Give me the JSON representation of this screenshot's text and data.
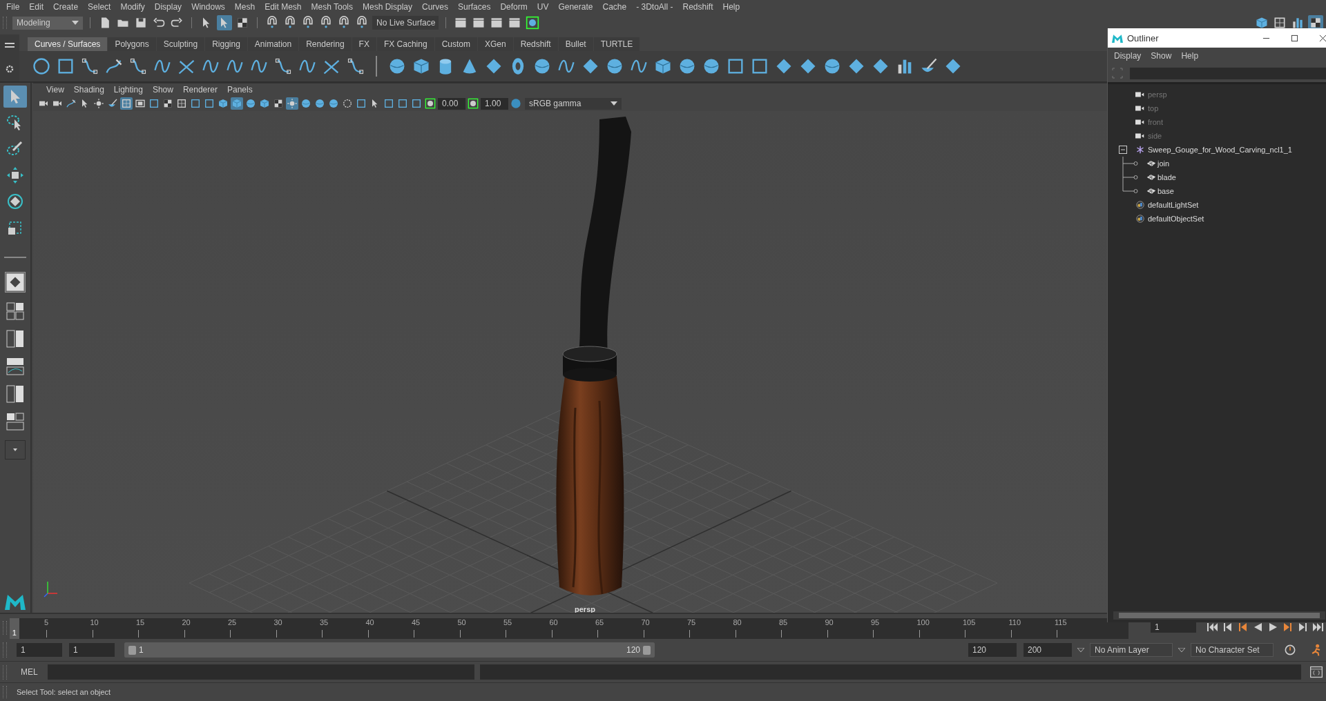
{
  "menu_bar": [
    "File",
    "Edit",
    "Create",
    "Select",
    "Modify",
    "Display",
    "Windows",
    "Mesh",
    "Edit Mesh",
    "Mesh Tools",
    "Mesh Display",
    "Curves",
    "Surfaces",
    "Deform",
    "UV",
    "Generate",
    "Cache",
    "- 3DtoAll -",
    "Redshift",
    "Help"
  ],
  "status_line": {
    "mode": "Modeling",
    "live_surface": "No Live Surface"
  },
  "shelf": {
    "tabs": [
      {
        "label": "Curves / Surfaces",
        "selected": true
      },
      {
        "label": "Polygons",
        "selected": false
      },
      {
        "label": "Sculpting",
        "selected": false
      },
      {
        "label": "Rigging",
        "selected": false
      },
      {
        "label": "Animation",
        "selected": false
      },
      {
        "label": "Rendering",
        "selected": false
      },
      {
        "label": "FX",
        "selected": false
      },
      {
        "label": "FX Caching",
        "selected": false
      },
      {
        "label": "Custom",
        "selected": false
      },
      {
        "label": "XGen",
        "selected": false
      },
      {
        "label": "Redshift",
        "selected": false
      },
      {
        "label": "Bullet",
        "selected": false
      },
      {
        "label": "TURTLE",
        "selected": false
      }
    ]
  },
  "toolbox": [
    {
      "kind": "select",
      "selected": true
    },
    {
      "kind": "lasso",
      "selected": false
    },
    {
      "kind": "paint",
      "selected": false
    },
    {
      "kind": "move",
      "selected": false
    },
    {
      "kind": "rotate",
      "selected": false
    },
    {
      "kind": "scale",
      "selected": false
    }
  ],
  "panel_menu": [
    "View",
    "Shading",
    "Lighting",
    "Show",
    "Renderer",
    "Panels"
  ],
  "panel_toolbar": {
    "exposure": "0.00",
    "gamma": "1.00",
    "color_space": "sRGB gamma"
  },
  "viewport": {
    "camera_label": "persp"
  },
  "outliner": {
    "title": "Outliner",
    "menus": [
      "Display",
      "Show",
      "Help"
    ],
    "items": [
      {
        "label": "persp",
        "kind": "camera",
        "dimmed": true
      },
      {
        "label": "top",
        "kind": "camera",
        "dimmed": true
      },
      {
        "label": "front",
        "kind": "camera",
        "dimmed": true
      },
      {
        "label": "side",
        "kind": "camera",
        "dimmed": true
      },
      {
        "label": "Sweep_Gouge_for_Wood_Carving_ncl1_1",
        "kind": "group",
        "dimmed": false,
        "expanded": true,
        "children": [
          {
            "label": "join",
            "kind": "mesh",
            "dimmed": false
          },
          {
            "label": "blade",
            "kind": "mesh",
            "dimmed": false
          },
          {
            "label": "base",
            "kind": "mesh",
            "dimmed": false
          }
        ]
      },
      {
        "label": "defaultLightSet",
        "kind": "set",
        "dimmed": false
      },
      {
        "label": "defaultObjectSet",
        "kind": "set",
        "dimmed": false
      }
    ]
  },
  "time_slider": {
    "current_frame": "1",
    "level": 0,
    "ticks": [
      "5",
      "10",
      "15",
      "20",
      "25",
      "30",
      "35",
      "40",
      "45",
      "50",
      "55",
      "60",
      "65",
      "70",
      "75",
      "80",
      "85",
      "90",
      "95",
      "100",
      "105",
      "110",
      "115"
    ],
    "frame_field": "1"
  },
  "range_slider": {
    "level": 1,
    "start": "1",
    "playback_start": "1",
    "range_start": "1",
    "range_end": "120",
    "playback_end": "120",
    "end": "200",
    "anim_layer": "No Anim Layer",
    "character_set": "No Character Set"
  },
  "command_line": {
    "label": "MEL"
  },
  "help_line": "Select Tool: select an object"
}
